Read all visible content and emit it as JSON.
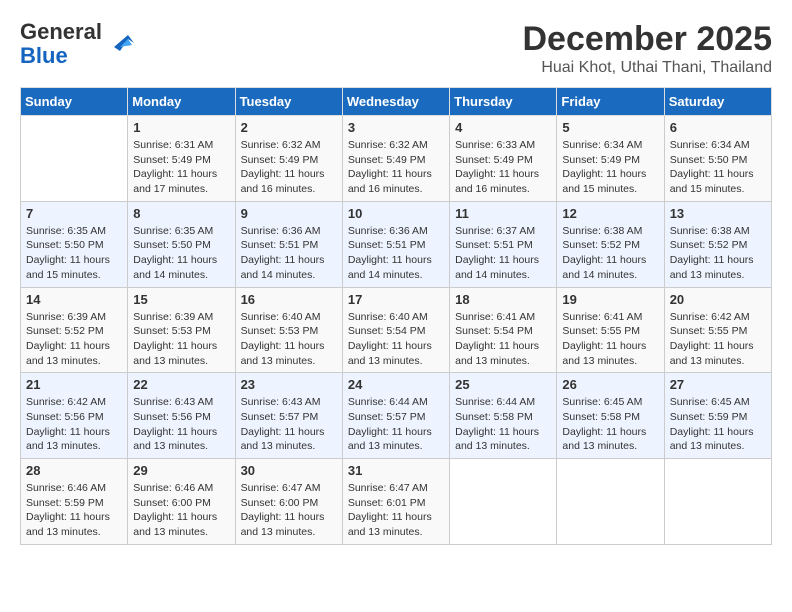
{
  "header": {
    "logo_general": "General",
    "logo_blue": "Blue",
    "title": "December 2025",
    "subtitle": "Huai Khot, Uthai Thani, Thailand"
  },
  "calendar": {
    "days_of_week": [
      "Sunday",
      "Monday",
      "Tuesday",
      "Wednesday",
      "Thursday",
      "Friday",
      "Saturday"
    ],
    "weeks": [
      [
        {
          "day": "",
          "sunrise": "",
          "sunset": "",
          "daylight": ""
        },
        {
          "day": "1",
          "sunrise": "6:31 AM",
          "sunset": "5:49 PM",
          "daylight": "11 hours and 17 minutes."
        },
        {
          "day": "2",
          "sunrise": "6:32 AM",
          "sunset": "5:49 PM",
          "daylight": "11 hours and 16 minutes."
        },
        {
          "day": "3",
          "sunrise": "6:32 AM",
          "sunset": "5:49 PM",
          "daylight": "11 hours and 16 minutes."
        },
        {
          "day": "4",
          "sunrise": "6:33 AM",
          "sunset": "5:49 PM",
          "daylight": "11 hours and 16 minutes."
        },
        {
          "day": "5",
          "sunrise": "6:34 AM",
          "sunset": "5:49 PM",
          "daylight": "11 hours and 15 minutes."
        },
        {
          "day": "6",
          "sunrise": "6:34 AM",
          "sunset": "5:50 PM",
          "daylight": "11 hours and 15 minutes."
        }
      ],
      [
        {
          "day": "7",
          "sunrise": "6:35 AM",
          "sunset": "5:50 PM",
          "daylight": "11 hours and 15 minutes."
        },
        {
          "day": "8",
          "sunrise": "6:35 AM",
          "sunset": "5:50 PM",
          "daylight": "11 hours and 14 minutes."
        },
        {
          "day": "9",
          "sunrise": "6:36 AM",
          "sunset": "5:51 PM",
          "daylight": "11 hours and 14 minutes."
        },
        {
          "day": "10",
          "sunrise": "6:36 AM",
          "sunset": "5:51 PM",
          "daylight": "11 hours and 14 minutes."
        },
        {
          "day": "11",
          "sunrise": "6:37 AM",
          "sunset": "5:51 PM",
          "daylight": "11 hours and 14 minutes."
        },
        {
          "day": "12",
          "sunrise": "6:38 AM",
          "sunset": "5:52 PM",
          "daylight": "11 hours and 14 minutes."
        },
        {
          "day": "13",
          "sunrise": "6:38 AM",
          "sunset": "5:52 PM",
          "daylight": "11 hours and 13 minutes."
        }
      ],
      [
        {
          "day": "14",
          "sunrise": "6:39 AM",
          "sunset": "5:52 PM",
          "daylight": "11 hours and 13 minutes."
        },
        {
          "day": "15",
          "sunrise": "6:39 AM",
          "sunset": "5:53 PM",
          "daylight": "11 hours and 13 minutes."
        },
        {
          "day": "16",
          "sunrise": "6:40 AM",
          "sunset": "5:53 PM",
          "daylight": "11 hours and 13 minutes."
        },
        {
          "day": "17",
          "sunrise": "6:40 AM",
          "sunset": "5:54 PM",
          "daylight": "11 hours and 13 minutes."
        },
        {
          "day": "18",
          "sunrise": "6:41 AM",
          "sunset": "5:54 PM",
          "daylight": "11 hours and 13 minutes."
        },
        {
          "day": "19",
          "sunrise": "6:41 AM",
          "sunset": "5:55 PM",
          "daylight": "11 hours and 13 minutes."
        },
        {
          "day": "20",
          "sunrise": "6:42 AM",
          "sunset": "5:55 PM",
          "daylight": "11 hours and 13 minutes."
        }
      ],
      [
        {
          "day": "21",
          "sunrise": "6:42 AM",
          "sunset": "5:56 PM",
          "daylight": "11 hours and 13 minutes."
        },
        {
          "day": "22",
          "sunrise": "6:43 AM",
          "sunset": "5:56 PM",
          "daylight": "11 hours and 13 minutes."
        },
        {
          "day": "23",
          "sunrise": "6:43 AM",
          "sunset": "5:57 PM",
          "daylight": "11 hours and 13 minutes."
        },
        {
          "day": "24",
          "sunrise": "6:44 AM",
          "sunset": "5:57 PM",
          "daylight": "11 hours and 13 minutes."
        },
        {
          "day": "25",
          "sunrise": "6:44 AM",
          "sunset": "5:58 PM",
          "daylight": "11 hours and 13 minutes."
        },
        {
          "day": "26",
          "sunrise": "6:45 AM",
          "sunset": "5:58 PM",
          "daylight": "11 hours and 13 minutes."
        },
        {
          "day": "27",
          "sunrise": "6:45 AM",
          "sunset": "5:59 PM",
          "daylight": "11 hours and 13 minutes."
        }
      ],
      [
        {
          "day": "28",
          "sunrise": "6:46 AM",
          "sunset": "5:59 PM",
          "daylight": "11 hours and 13 minutes."
        },
        {
          "day": "29",
          "sunrise": "6:46 AM",
          "sunset": "6:00 PM",
          "daylight": "11 hours and 13 minutes."
        },
        {
          "day": "30",
          "sunrise": "6:47 AM",
          "sunset": "6:00 PM",
          "daylight": "11 hours and 13 minutes."
        },
        {
          "day": "31",
          "sunrise": "6:47 AM",
          "sunset": "6:01 PM",
          "daylight": "11 hours and 13 minutes."
        },
        {
          "day": "",
          "sunrise": "",
          "sunset": "",
          "daylight": ""
        },
        {
          "day": "",
          "sunrise": "",
          "sunset": "",
          "daylight": ""
        },
        {
          "day": "",
          "sunrise": "",
          "sunset": "",
          "daylight": ""
        }
      ]
    ]
  }
}
